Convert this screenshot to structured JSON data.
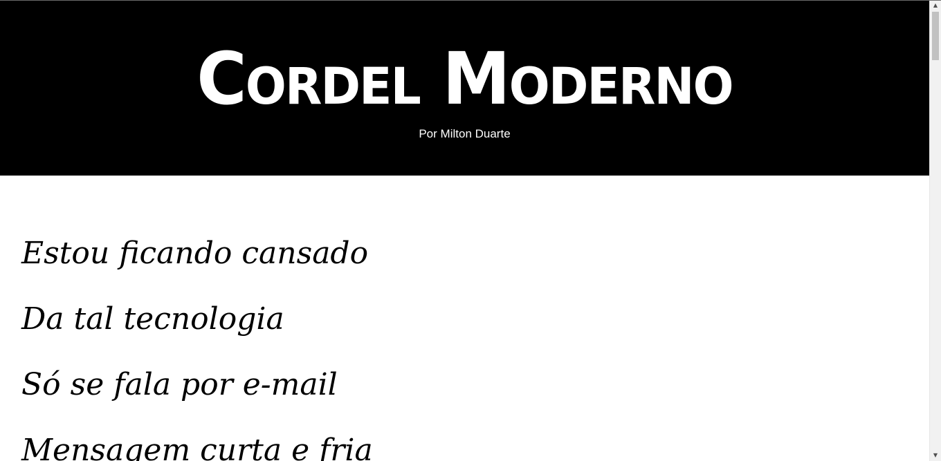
{
  "header": {
    "title": "Cordel Moderno",
    "byline_prefix": "Por",
    "author": "Milton Duarte"
  },
  "poem": {
    "verses": [
      "Estou ficando cansado",
      "Da tal tecnologia",
      "Só se fala por e-mail",
      "Mensagem curta e fria"
    ]
  },
  "scrollbar": {
    "up_icon": "triangle-up",
    "down_icon": "triangle-down"
  }
}
